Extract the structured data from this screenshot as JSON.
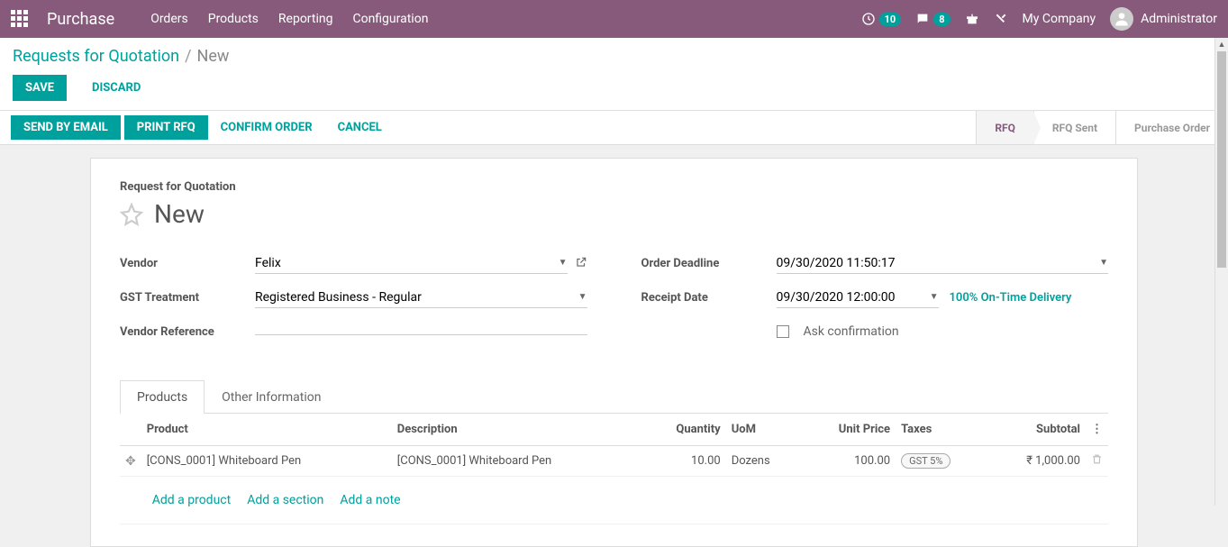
{
  "nav": {
    "app_title": "Purchase",
    "menu": [
      "Orders",
      "Products",
      "Reporting",
      "Configuration"
    ],
    "clock_badge": "10",
    "chat_badge": "8",
    "company": "My Company",
    "user": "Administrator"
  },
  "breadcrumb": {
    "root": "Requests for Quotation",
    "current": "New"
  },
  "actions": {
    "save": "Save",
    "discard": "Discard"
  },
  "statusbar": {
    "send_email": "Send by Email",
    "print": "Print RFQ",
    "confirm": "Confirm Order",
    "cancel": "Cancel",
    "steps": [
      "RFQ",
      "RFQ Sent",
      "Purchase Order"
    ]
  },
  "form": {
    "subtitle": "Request for Quotation",
    "title": "New",
    "labels": {
      "vendor": "Vendor",
      "gst": "GST Treatment",
      "vendor_ref": "Vendor Reference",
      "deadline": "Order Deadline",
      "receipt": "Receipt Date",
      "ask_confirm": "Ask confirmation"
    },
    "values": {
      "vendor": "Felix",
      "gst": "Registered Business - Regular",
      "vendor_ref": "",
      "deadline": "09/30/2020 11:50:17",
      "receipt": "09/30/2020 12:00:00",
      "ontime": "100% On-Time Delivery"
    }
  },
  "tabs": [
    "Products",
    "Other Information"
  ],
  "table": {
    "headers": {
      "product": "Product",
      "description": "Description",
      "qty": "Quantity",
      "uom": "UoM",
      "unit_price": "Unit Price",
      "taxes": "Taxes",
      "subtotal": "Subtotal"
    },
    "rows": [
      {
        "product": "[CONS_0001] Whiteboard Pen",
        "description": "[CONS_0001] Whiteboard Pen",
        "qty": "10.00",
        "uom": "Dozens",
        "unit_price": "100.00",
        "tax": "GST 5%",
        "subtotal": "₹ 1,000.00"
      }
    ],
    "add": {
      "product": "Add a product",
      "section": "Add a section",
      "note": "Add a note"
    }
  }
}
